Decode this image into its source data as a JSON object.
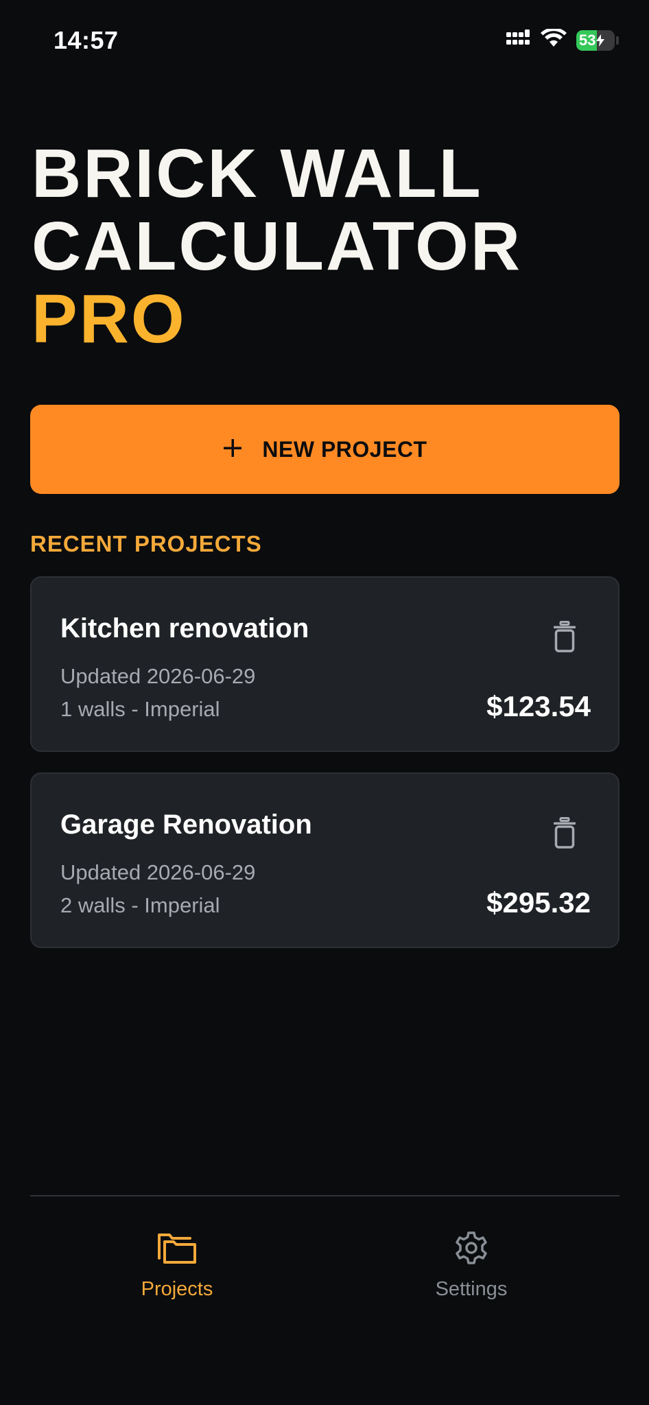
{
  "status_bar": {
    "time": "14:57",
    "battery_level": "53",
    "icons": [
      "signal-icon",
      "wifi-icon",
      "battery-charging-icon"
    ]
  },
  "title": {
    "line1": "BRICK WALL",
    "line2": "CALCULATOR",
    "line3": "PRO"
  },
  "new_project_button": {
    "label": "NEW PROJECT",
    "icon": "plus-icon"
  },
  "recent_projects": {
    "heading": "RECENT PROJECTS",
    "items": [
      {
        "name": "Kitchen renovation",
        "updated": "Updated 2026-06-29",
        "meta": "1 walls - Imperial",
        "total": "$123.54"
      },
      {
        "name": "Garage Renovation",
        "updated": "Updated 2026-06-29",
        "meta": "2 walls - Imperial",
        "total": "$295.32"
      }
    ]
  },
  "bottom_nav": {
    "items": [
      {
        "label": "Projects",
        "icon": "folder-icon",
        "active": true
      },
      {
        "label": "Settings",
        "icon": "gear-icon",
        "active": false
      }
    ]
  },
  "colors": {
    "background": "#0b0c0e",
    "accent_orange": "#ff8a24",
    "accent_yellow": "#fbb32e",
    "card_background": "#1f2226",
    "muted_text": "#a7abb1",
    "battery_green": "#34c759"
  }
}
